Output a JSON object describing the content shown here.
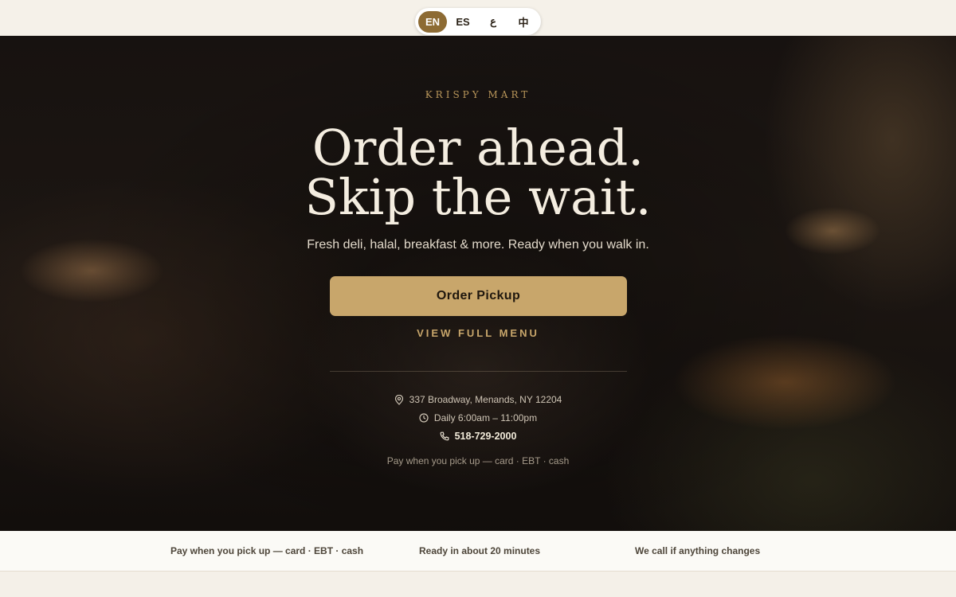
{
  "language_switcher": {
    "options": [
      {
        "label": "EN",
        "active": true
      },
      {
        "label": "ES",
        "active": false
      },
      {
        "label": "ع",
        "active": false
      },
      {
        "label": "中",
        "active": false
      }
    ]
  },
  "hero": {
    "brand": "KRISPY MART",
    "headline_line1": "Order ahead.",
    "headline_line2": "Skip the wait.",
    "subhead": "Fresh deli, halal, breakfast & more. Ready when you walk in.",
    "order_button_label": "Order Pickup",
    "menu_link_label": "VIEW FULL MENU",
    "address": "337 Broadway, Menands, NY 12204",
    "hours": "Daily 6:00am – 11:00pm",
    "phone": "518-729-2000",
    "payment_note": "Pay when you pick up — card · EBT · cash"
  },
  "feature_strip": {
    "items": [
      "Pay when you pick up — card · EBT · cash",
      "Ready in about 20 minutes",
      "We call if anything changes"
    ]
  },
  "colors": {
    "accent_gold": "#c8a66b",
    "active_lang_bg": "#8d6b34",
    "hero_bg": "#171210",
    "cream": "#f4f0e8"
  },
  "icons": {
    "address": "map-pin-icon",
    "hours": "clock-icon",
    "phone": "phone-icon"
  }
}
